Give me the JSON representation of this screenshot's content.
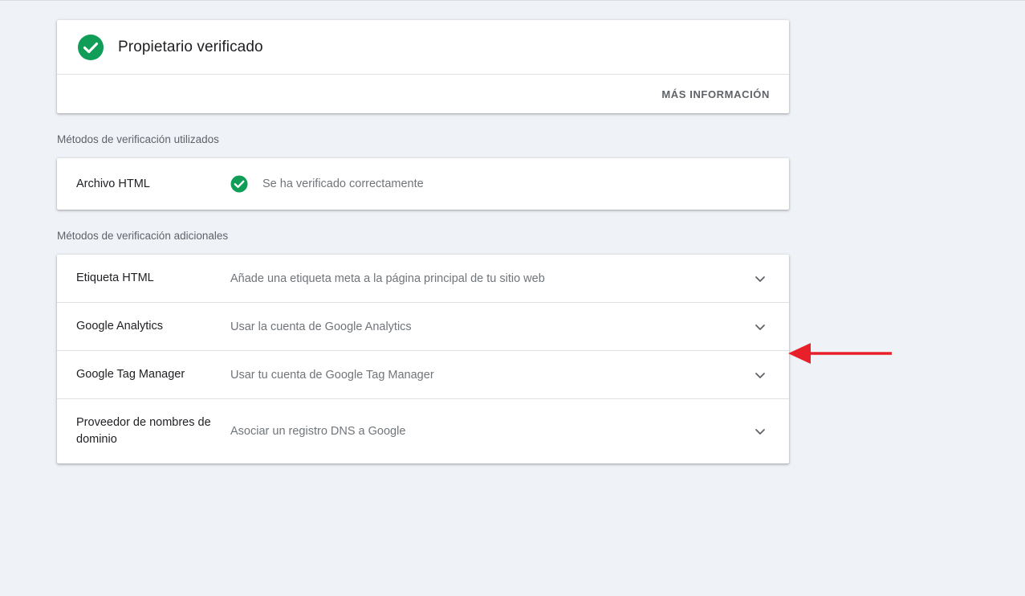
{
  "owner": {
    "title": "Propietario verificado",
    "more_info_label": "MÁS INFORMACIÓN"
  },
  "used_methods": {
    "section_label": "Métodos de verificación utilizados",
    "items": [
      {
        "title": "Archivo HTML",
        "status": "Se ha verificado correctamente"
      }
    ]
  },
  "additional_methods": {
    "section_label": "Métodos de verificación adicionales",
    "items": [
      {
        "title": "Etiqueta HTML",
        "description": "Añade una etiqueta meta a la página principal de tu sitio web"
      },
      {
        "title": "Google Analytics",
        "description": "Usar la cuenta de Google Analytics"
      },
      {
        "title": "Google Tag Manager",
        "description": "Usar tu cuenta de Google Tag Manager"
      },
      {
        "title": "Proveedor de nombres de dominio",
        "description": "Asociar un registro DNS a Google"
      }
    ]
  },
  "colors": {
    "verified_green": "#0f9d58",
    "annotation_arrow": "#e8202a",
    "background": "#eff2f7"
  },
  "icons": {
    "verified": "check-circle-icon",
    "expand": "chevron-down-icon",
    "annotation": "red-arrow-icon"
  }
}
